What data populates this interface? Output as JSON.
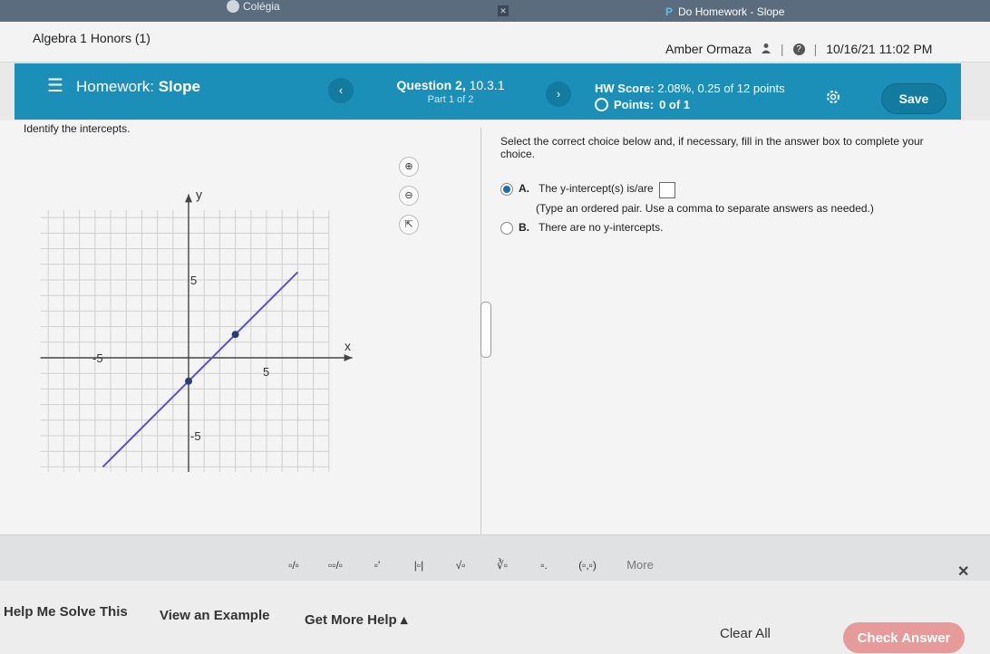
{
  "browser": {
    "tab_left": "Colégia",
    "tab_close": "✕",
    "tab_right_icon": "P",
    "tab_right": "Do Homework - Slope"
  },
  "course": {
    "title": "Algebra 1 Honors (1)",
    "user": "Amber Ormaza",
    "datetime": "10/16/21 11:02 PM"
  },
  "homework": {
    "label": "Homework:",
    "name": "Slope",
    "question_title": "Question 2,",
    "question_num": "10.3.1",
    "part": "Part 1 of 2",
    "hw_score_label": "HW Score:",
    "hw_score": "2.08%, 0.25 of 12 points",
    "points_label": "Points:",
    "points": "0 of 1",
    "save_label": "Save",
    "prev_glyph": "‹",
    "next_glyph": "›"
  },
  "question": {
    "prompt": "Identify the intercepts.",
    "instruction": "Select the correct choice below and, if necessary, fill in the answer box to complete your choice.",
    "choice_a_letter": "A.",
    "choice_a_text": "The y-intercept(s) is/are",
    "choice_a_hint": "(Type an ordered pair. Use a comma to separate answers as needed.)",
    "choice_b_letter": "B.",
    "choice_b_text": "There are no y-intercepts.",
    "selected": "A"
  },
  "graph": {
    "x_label": "x",
    "y_label": "y",
    "tick_neg5": "-5",
    "tick_pos5": "5",
    "line_color": "#5a4fe0",
    "point_color": "#2a3f6f",
    "line_points": [
      [
        -5.5,
        -7
      ],
      [
        7,
        5.5
      ]
    ],
    "marked_points": [
      [
        0,
        -1.5
      ],
      [
        3,
        1.5
      ]
    ]
  },
  "math_toolbar": {
    "buttons": [
      "▫/▫",
      "▫▫/▫",
      "▫'",
      "|▫|",
      "√▫",
      "∛▫",
      "▫.",
      "(▫,▫)"
    ],
    "more_label": "More",
    "close_glyph": "✕"
  },
  "bottom": {
    "help_me": "Help Me Solve This",
    "example": "View an Example",
    "more_help": "Get More Help ▴",
    "clear_all": "Clear All",
    "check_answer": "Check Answer"
  },
  "colors": {
    "header_blue": "#1b8fb8",
    "check_answer_bg": "#e79a9a"
  }
}
